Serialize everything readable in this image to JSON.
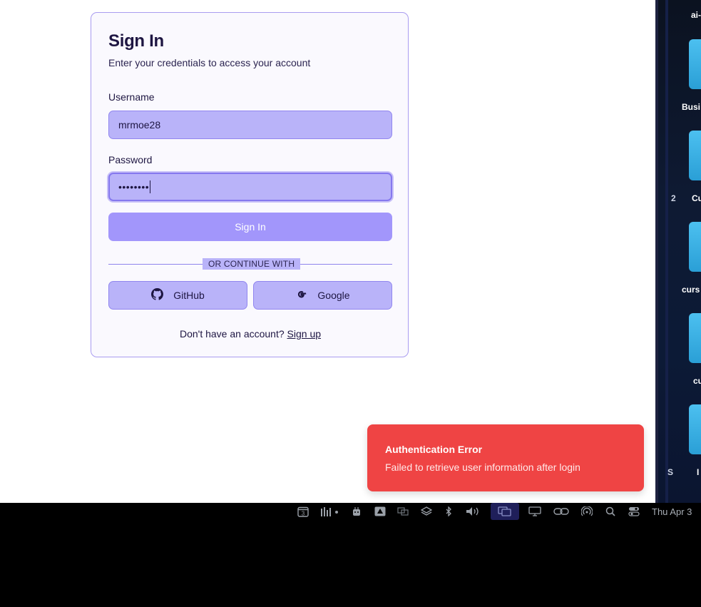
{
  "signin": {
    "title": "Sign In",
    "subtitle": "Enter your credentials to access your account",
    "username_label": "Username",
    "username_value": "mrmoe28",
    "password_label": "Password",
    "password_mask": "••••••••",
    "submit_label": "Sign In",
    "divider_text": "OR CONTINUE WITH",
    "github_label": "GitHub",
    "google_label": "Google",
    "signup_prompt": "Don't have an account?",
    "signup_link": "Sign up"
  },
  "toast": {
    "title": "Authentication Error",
    "message": "Failed to retrieve user information after login",
    "color": "#ef4444"
  },
  "desktop": {
    "labels": [
      "ai-",
      "Busi",
      "Cu",
      "curs",
      "cu",
      "I"
    ],
    "side_numbers": [
      "2",
      "S"
    ]
  },
  "menubar": {
    "calendar_badge": "3",
    "clock": "Thu Apr 3",
    "icons": [
      "calendar-icon",
      "audio-levels-icon",
      "robot-icon",
      "drive-icon",
      "screens-icon",
      "layers-icon",
      "bluetooth-icon",
      "volume-icon",
      "windows-icon",
      "display-icon",
      "link-icon",
      "airdrop-icon",
      "search-icon",
      "control-center-icon"
    ]
  },
  "colors": {
    "accent": "#a296fb",
    "input_bg": "#b9b3f9",
    "card_border": "#a99cf0",
    "heading": "#1e1642"
  }
}
